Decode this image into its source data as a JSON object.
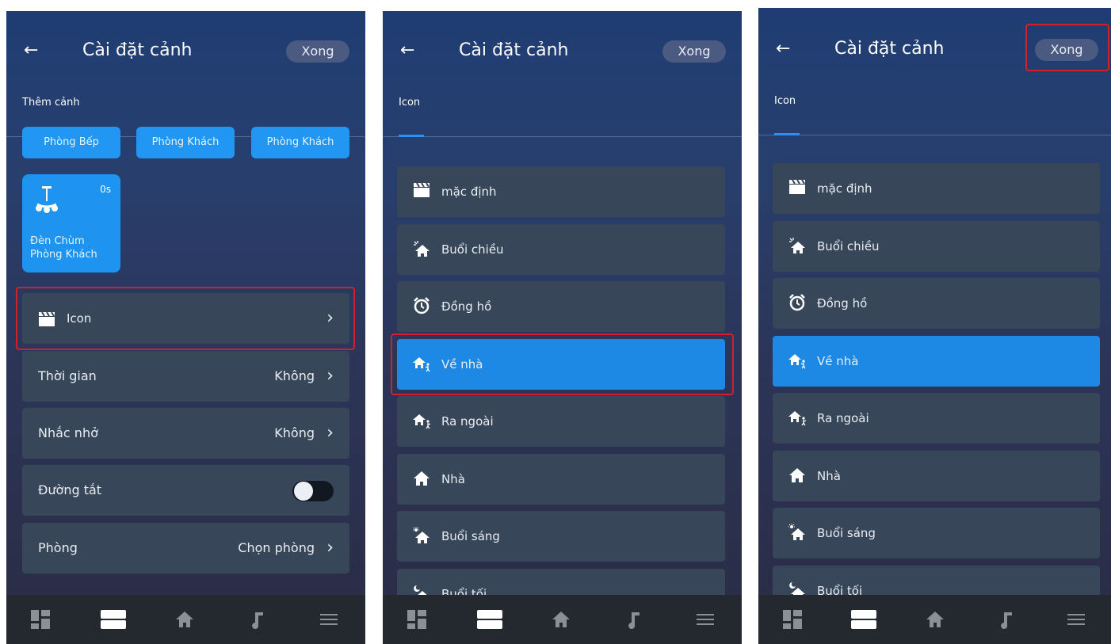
{
  "common": {
    "back_glyph": "←",
    "title": "Cài đặt cảnh",
    "done_label": "Xong",
    "colors": {
      "accent": "#1e88e5",
      "highlight": "#d11f2b",
      "row_bg": "#374659",
      "nav_bg": "#23292f"
    }
  },
  "screen1": {
    "tab_label": "Thêm cảnh",
    "chips": [
      "Phòng Bếp",
      "Phòng Khách",
      "Phòng Khách"
    ],
    "device": {
      "time": "0s",
      "name_line1": "Đèn Chùm",
      "name_line2": "Phòng Khách",
      "icon": "chandelier-icon"
    },
    "rows": [
      {
        "label": "Icon",
        "value": "",
        "icon": "clapperboard-icon"
      },
      {
        "label": "Thời gian",
        "value": "Không"
      },
      {
        "label": "Nhắc nhở",
        "value": "Không"
      },
      {
        "label": "Đường tắt",
        "toggle": false
      },
      {
        "label": "Phòng",
        "value": "Chọn phòng"
      }
    ]
  },
  "icon_list": {
    "tab_label": "Icon",
    "items": [
      {
        "label": "mặc định",
        "icon": "clapperboard-icon"
      },
      {
        "label": "Buổi chiều",
        "icon": "afternoon-house-icon"
      },
      {
        "label": "Đồng hồ",
        "icon": "alarm-clock-icon"
      },
      {
        "label": "Về nhà",
        "icon": "come-home-icon",
        "selected": true
      },
      {
        "label": "Ra ngoài",
        "icon": "go-out-icon"
      },
      {
        "label": "Nhà",
        "icon": "home-icon"
      },
      {
        "label": "Buổi sáng",
        "icon": "morning-house-icon"
      },
      {
        "label": "Buổi tối",
        "icon": "evening-house-icon"
      }
    ]
  },
  "nav_icons": [
    "dashboard-icon",
    "scenes-icon",
    "home-icon",
    "music-icon",
    "menu-icon"
  ],
  "chevron": "›"
}
